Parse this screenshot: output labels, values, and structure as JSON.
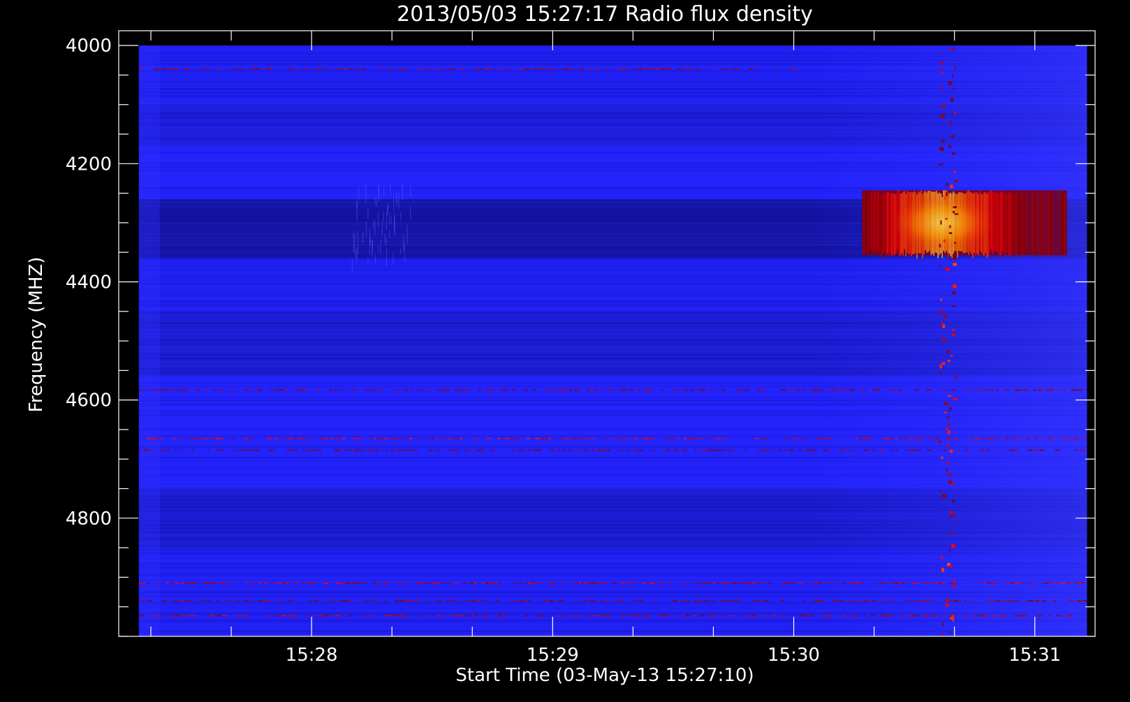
{
  "chart_data": {
    "type": "heatmap",
    "title": "2013/05/03 15:27:17 Radio flux density",
    "xlabel": "Start Time (03-May-13 15:27:10)",
    "ylabel": "Frequency (MHZ)",
    "x_axis": {
      "unit": "time",
      "range": [
        "15:27:12",
        "15:31:15"
      ],
      "data_range": [
        "15:27:17",
        "15:31:13"
      ],
      "major_ticks": [
        "15:28",
        "15:29",
        "15:30",
        "15:31"
      ],
      "minor_tick_interval_s": 20
    },
    "y_axis": {
      "unit": "MHz",
      "range": [
        3975,
        5000
      ],
      "data_range": [
        4000,
        5000
      ],
      "major_ticks": [
        4000,
        4200,
        4400,
        4600,
        4800
      ],
      "minor_tick_interval": 50,
      "inverted": true
    },
    "colormap": [
      "#1a1acc",
      "#2323ff",
      "#800000",
      "#ff0000",
      "#ff8c00",
      "#ffff80"
    ],
    "background_bands": [
      {
        "freq": [
          4000,
          4100
        ],
        "level": 0.12
      },
      {
        "freq": [
          4100,
          4170
        ],
        "level": 0.09
      },
      {
        "freq": [
          4170,
          4260
        ],
        "level": 0.13
      },
      {
        "freq": [
          4260,
          4360
        ],
        "level": 0.02
      },
      {
        "freq": [
          4360,
          4450
        ],
        "level": 0.12
      },
      {
        "freq": [
          4450,
          4560
        ],
        "level": 0.08
      },
      {
        "freq": [
          4560,
          4750
        ],
        "level": 0.13
      },
      {
        "freq": [
          4750,
          4850
        ],
        "level": 0.08
      },
      {
        "freq": [
          4850,
          5000
        ],
        "level": 0.12
      }
    ],
    "rfi_lines": [
      {
        "freq": 4040,
        "t_end": "15:30:00",
        "level": 0.35
      },
      {
        "freq": 4583,
        "t_end": "15:31:13",
        "level": 0.32
      },
      {
        "freq": 4665,
        "t_end": "15:31:13",
        "level": 0.45
      },
      {
        "freq": 4685,
        "t_end": "15:31:13",
        "level": 0.3
      },
      {
        "freq": 4910,
        "t_end": "15:31:13",
        "level": 0.42
      },
      {
        "freq": 4940,
        "t_end": "15:31:13",
        "level": 0.33
      },
      {
        "freq": 4965,
        "t_end": "15:31:13",
        "level": 0.38
      }
    ],
    "events": [
      {
        "label": "",
        "t_start": "15:30:17",
        "t_end": "15:31:08",
        "freq": [
          4245,
          4355
        ],
        "level": 0.8
      },
      {
        "label": "",
        "t_start": "15:30:36",
        "t_end": "15:30:40",
        "freq": [
          4000,
          5000
        ],
        "level": 0.6
      }
    ]
  }
}
